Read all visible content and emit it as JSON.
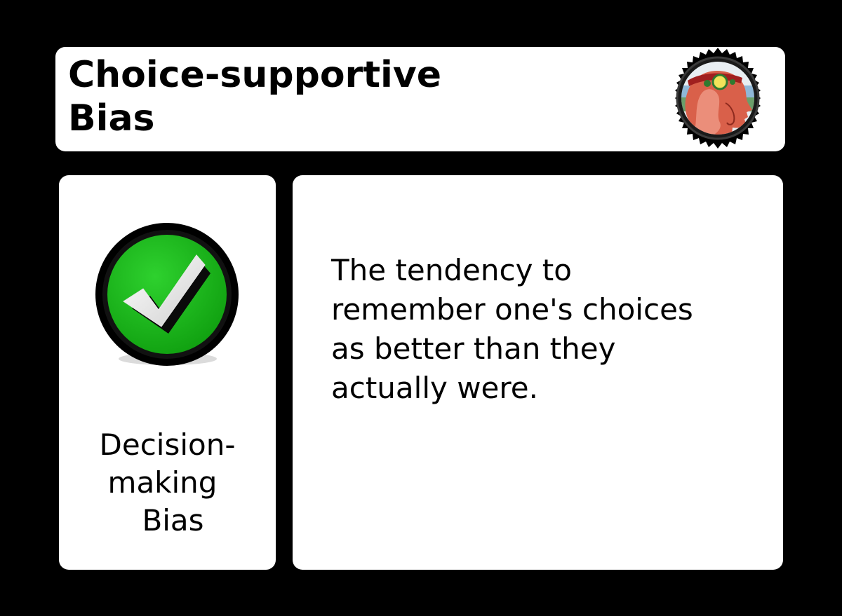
{
  "card": {
    "title_lines": [
      "Choice-supportive",
      "Bias"
    ],
    "category_lines": [
      "Decision-",
      "making",
      "Bias"
    ],
    "description_lines": [
      "The tendency to",
      "remember one's choices",
      "as better than they",
      "actually were."
    ]
  },
  "icons": {
    "seal": "profile-head-seal-icon",
    "category": "checkmark-icon"
  },
  "colors": {
    "background": "#000000",
    "panel": "#ffffff",
    "check_green": "#1db81d",
    "seal_red": "#c0392b"
  }
}
